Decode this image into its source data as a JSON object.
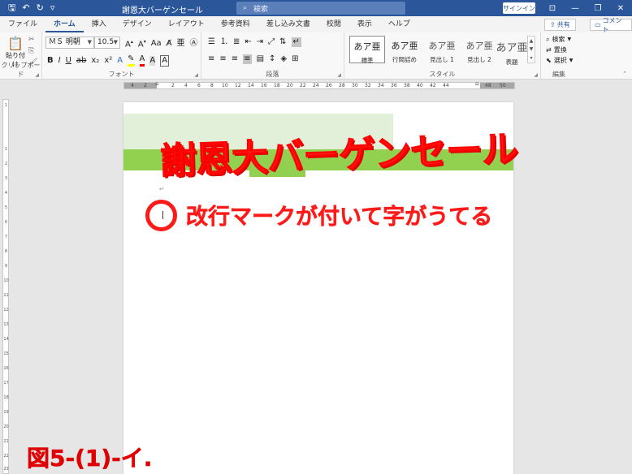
{
  "titlebar": {
    "doc_title": "謝恩大バーゲンセール",
    "search_placeholder": "検索",
    "signin": "サインイン",
    "qa_icons": [
      "save-icon",
      "undo-icon",
      "redo-icon",
      "customize-icon"
    ]
  },
  "tabs": [
    "ファイル",
    "ホーム",
    "挿入",
    "デザイン",
    "レイアウト",
    "参考資料",
    "差し込み文書",
    "校閲",
    "表示",
    "ヘルプ"
  ],
  "active_tab": "ホーム",
  "share_label": "共有",
  "comment_label": "コメント",
  "ribbon": {
    "clipboard": {
      "paste_label": "貼り付け",
      "group_label": "クリップボード"
    },
    "font": {
      "font_name": "ＭＳ 明朝",
      "font_size": "10.5",
      "group_label": "フォント"
    },
    "paragraph": {
      "group_label": "段落"
    },
    "styles": {
      "group_label": "スタイル",
      "items": [
        {
          "preview": "あア亜",
          "label": "標準"
        },
        {
          "preview": "あア亜",
          "label": "行間詰め"
        },
        {
          "preview": "あア亜",
          "label": "見出し 1"
        },
        {
          "preview": "あア亜",
          "label": "見出し 2"
        },
        {
          "preview": "あア亜",
          "label": "表題"
        }
      ]
    },
    "editing": {
      "group_label": "編集",
      "search": "検索",
      "replace": "置換",
      "select": "選択"
    }
  },
  "ruler_ticks": [
    "4",
    "2",
    "2",
    "4",
    "6",
    "8",
    "10",
    "12",
    "14",
    "16",
    "18",
    "20",
    "22",
    "24",
    "26",
    "28",
    "30",
    "32",
    "34",
    "36",
    "38",
    "40",
    "42",
    "44",
    "48",
    "50"
  ],
  "vruler_ticks": [
    "1",
    "1",
    "2",
    "3",
    "4",
    "5",
    "6",
    "7",
    "8",
    "9",
    "10",
    "11",
    "12",
    "13",
    "14",
    "15",
    "16",
    "17",
    "18",
    "19",
    "20",
    "21",
    "22",
    "23"
  ],
  "document": {
    "title_text": "謝恩大バーゲンセール",
    "paragraph_mark": "↵"
  },
  "annotation": {
    "note": "改行マークが付いて字がうてる",
    "figure_label": "図5-(1)-イ."
  },
  "colors": {
    "titlebar": "#2b579a",
    "highlight_light_green": "#e2efd9",
    "highlight_green": "#92d050",
    "annotation_red": "#ff1a1a"
  }
}
